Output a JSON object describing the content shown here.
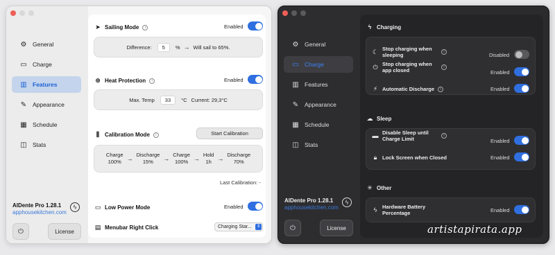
{
  "light_window": {
    "sidebar": {
      "items": [
        {
          "label": "General",
          "icon": "gear-icon"
        },
        {
          "label": "Charge",
          "icon": "battery-icon"
        },
        {
          "label": "Features",
          "icon": "chart-bars-icon"
        },
        {
          "label": "Appearance",
          "icon": "brush-icon"
        },
        {
          "label": "Schedule",
          "icon": "calendar-icon"
        },
        {
          "label": "Stats",
          "icon": "stats-icon"
        }
      ],
      "active": "Features",
      "app_name": "AlDente Pro 1.28.1",
      "app_link": "apphousekitchen.com",
      "license_label": "License"
    },
    "sailing": {
      "title": "Sailing Mode",
      "status": "Enabled",
      "difference_label": "Difference:",
      "difference_value": "5",
      "unit": "%",
      "result": "Will sail to 65%."
    },
    "heat": {
      "title": "Heat Protection",
      "status": "Enabled",
      "max_label": "Max. Temp",
      "max_value": "33",
      "unit": "°C",
      "current": "Current: 29,3°C"
    },
    "calibration": {
      "title": "Calibration Mode",
      "button": "Start Calibration",
      "steps": [
        {
          "l1": "Charge",
          "l2": "100%"
        },
        {
          "l1": "Discharge",
          "l2": "15%"
        },
        {
          "l1": "Charge",
          "l2": "100%"
        },
        {
          "l1": "Hold",
          "l2": "1h"
        },
        {
          "l1": "Discharge",
          "l2": "70%"
        }
      ],
      "last": "Last Calibration: -"
    },
    "low_power": {
      "title": "Low Power Mode",
      "status": "Enabled"
    },
    "menubar": {
      "title": "Menubar Right Click",
      "selected": "Charging Star..."
    }
  },
  "dark_window": {
    "sidebar": {
      "items": [
        {
          "label": "General",
          "icon": "gear-icon"
        },
        {
          "label": "Charge",
          "icon": "battery-icon"
        },
        {
          "label": "Features",
          "icon": "chart-bars-icon"
        },
        {
          "label": "Appearance",
          "icon": "brush-icon"
        },
        {
          "label": "Schedule",
          "icon": "calendar-icon"
        },
        {
          "label": "Stats",
          "icon": "stats-icon"
        }
      ],
      "active": "Charge",
      "app_name": "AlDente Pro 1.28.1",
      "app_link": "apphousekitchen.com",
      "license_label": "License"
    },
    "charging": {
      "title": "Charging",
      "rows": [
        {
          "label": "Stop charging when sleeping",
          "status": "Disabled",
          "on": false
        },
        {
          "label": "Stop charging when app closed",
          "status": "Enabled",
          "on": true
        },
        {
          "label": "Automatic Discharge",
          "status": "Enabled",
          "on": true
        }
      ]
    },
    "sleep": {
      "title": "Sleep",
      "rows": [
        {
          "label": "Disable Sleep until Charge Limit",
          "status": "Enabled",
          "on": true
        },
        {
          "label": "Lock Screen when Closed",
          "status": "Enabled",
          "on": true
        }
      ]
    },
    "other": {
      "title": "Other",
      "rows": [
        {
          "label": "Hardware Battery Percentage",
          "status": "Enabled",
          "on": true
        }
      ]
    }
  },
  "watermark": "artistapirata.app",
  "colors": {
    "accent": "#2f6fe0",
    "active_text_light": "#1b62d6",
    "active_text_dark": "#3b82f6"
  }
}
